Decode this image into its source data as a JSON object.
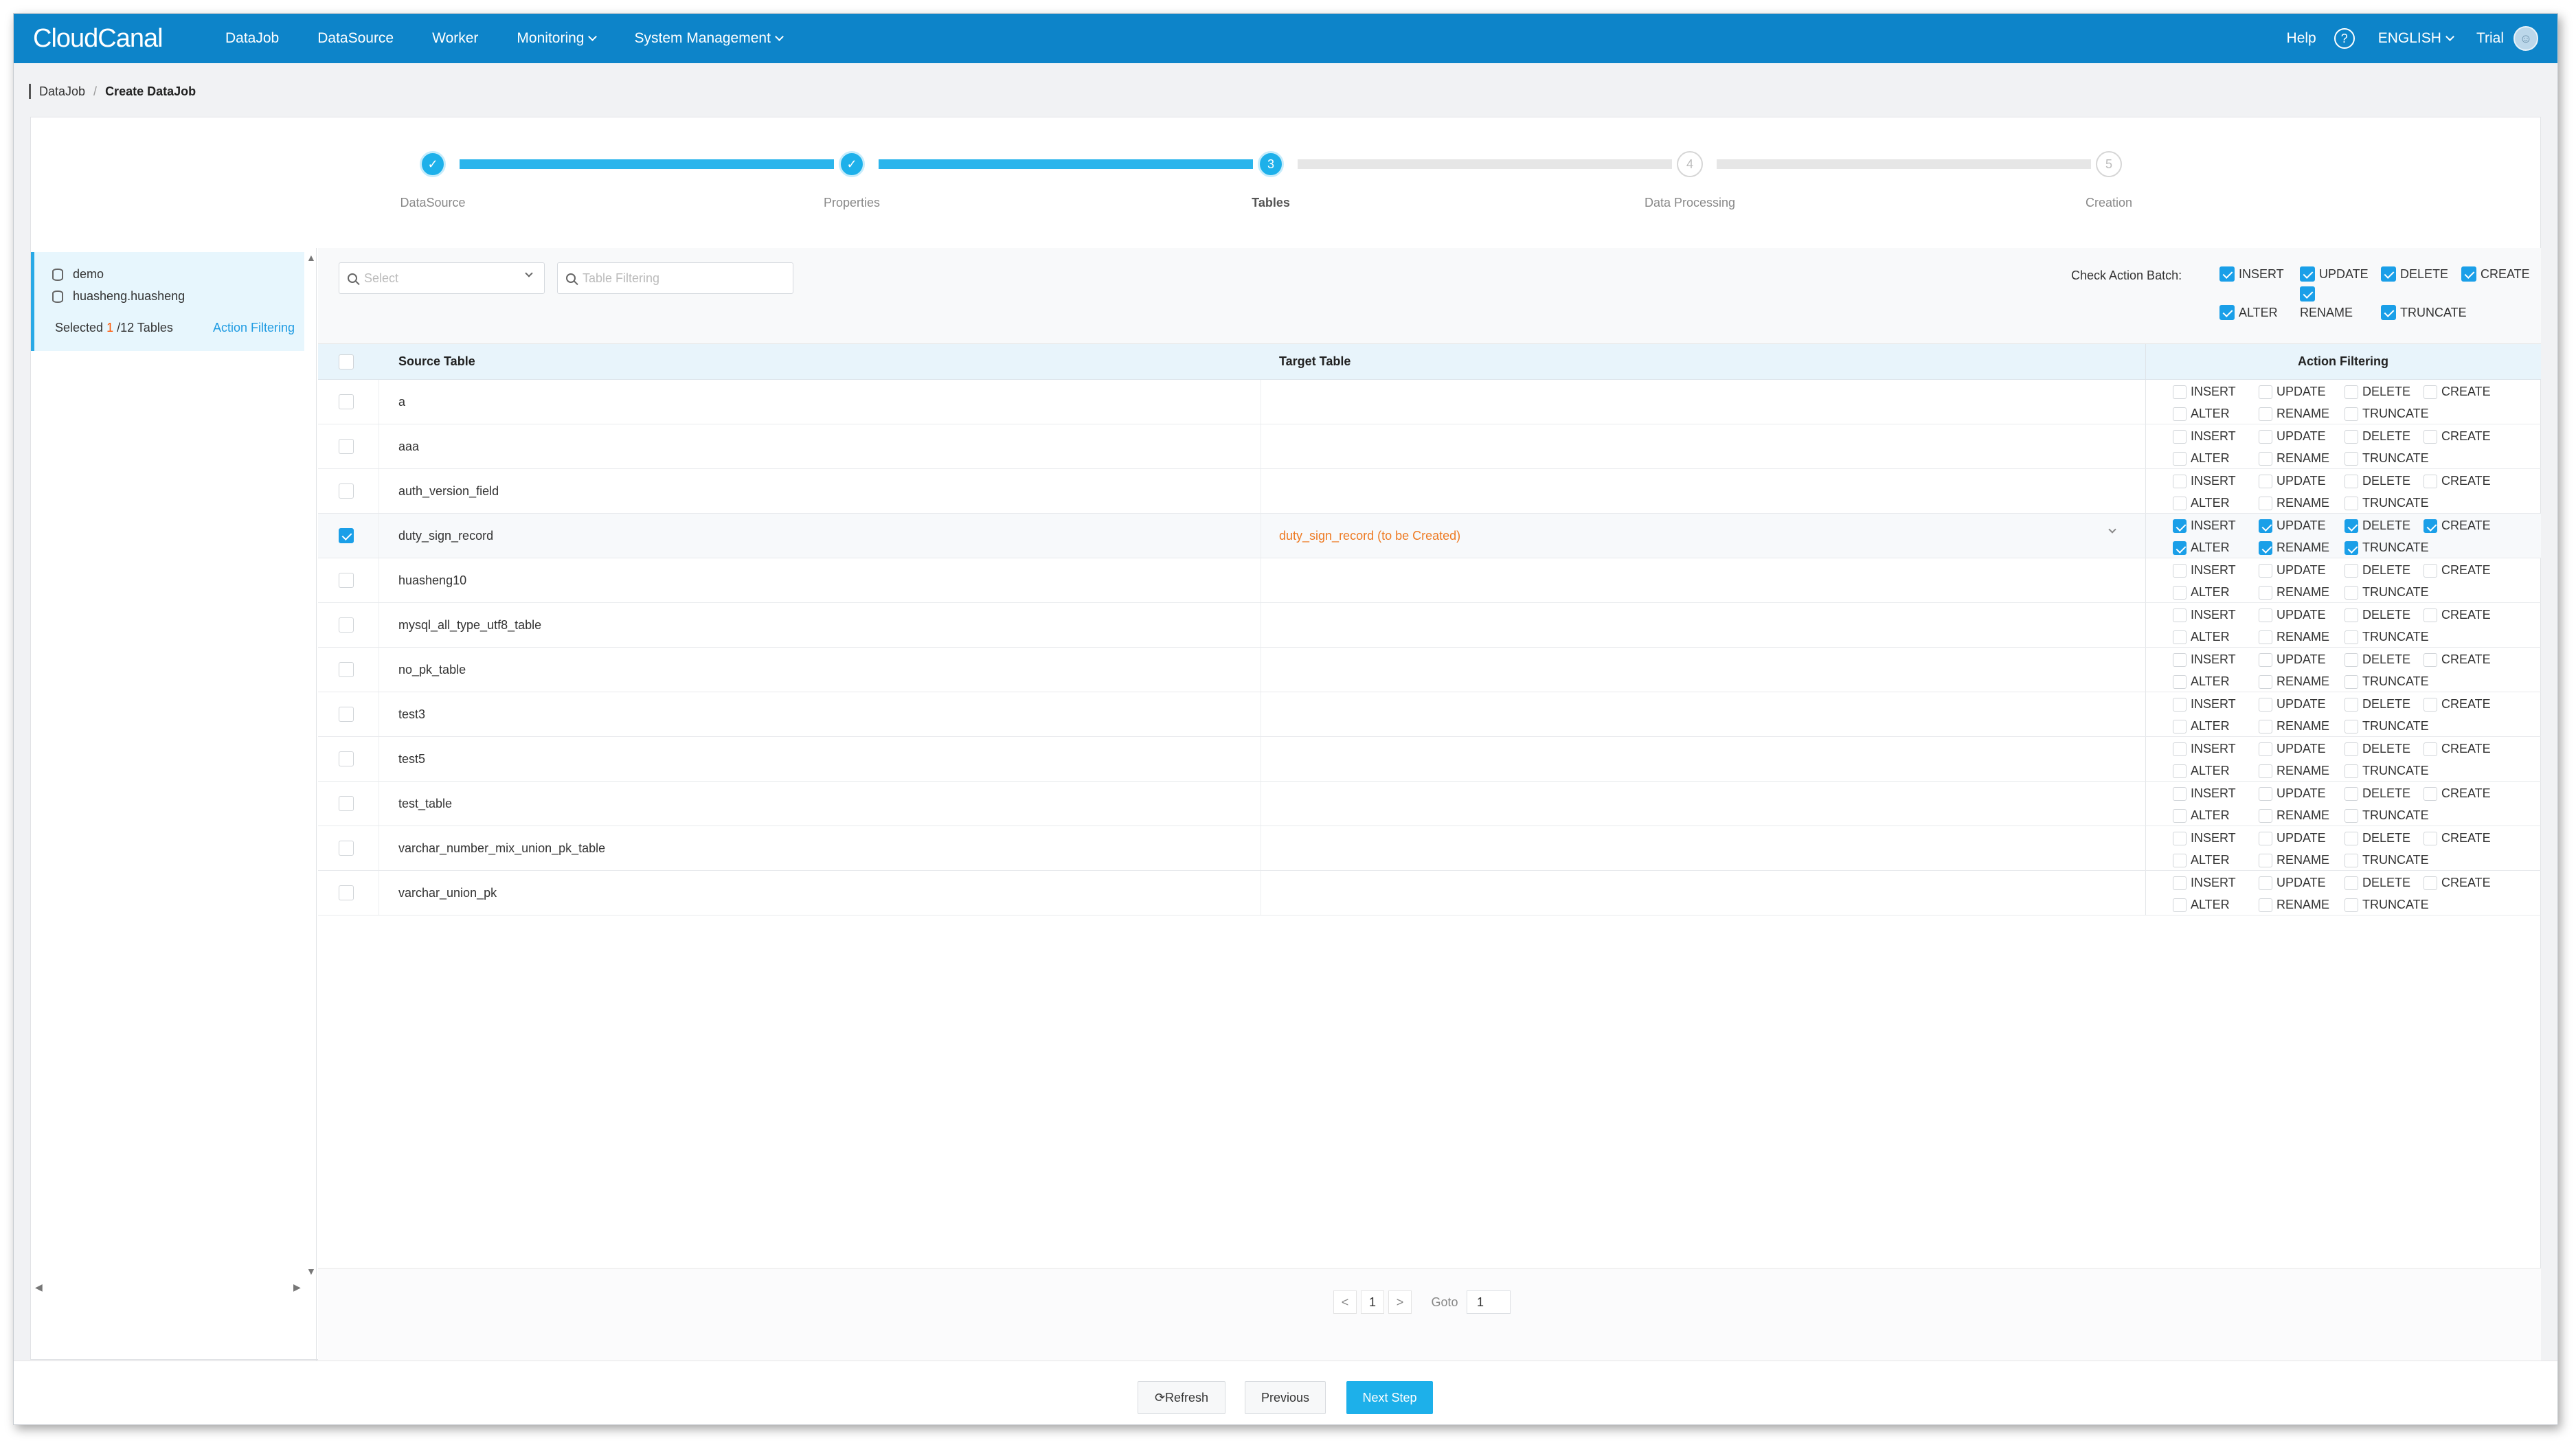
{
  "app": {
    "logo": "CloudCanal"
  },
  "topnav": {
    "items": [
      "DataJob",
      "DataSource",
      "Worker",
      "Monitoring",
      "System Management"
    ],
    "help": "Help",
    "help_icon": "?",
    "language": "ENGLISH",
    "user": "Trial"
  },
  "breadcrumb": {
    "parent": "DataJob",
    "separator": "/",
    "current": "Create DataJob"
  },
  "steps": [
    {
      "label": "DataSource",
      "status": "done",
      "symbol": "✓"
    },
    {
      "label": "Properties",
      "status": "done",
      "symbol": "✓"
    },
    {
      "label": "Tables",
      "status": "active",
      "symbol": "3"
    },
    {
      "label": "Data Processing",
      "status": "todo",
      "symbol": "4"
    },
    {
      "label": "Creation",
      "status": "todo",
      "symbol": "5"
    }
  ],
  "sidebar": {
    "db_name": "demo",
    "schema_name": "huasheng.huasheng",
    "selected_prefix": "Selected",
    "selected_count": "1",
    "selected_suffix": "/12 Tables",
    "action_filtering_link": "Action Filtering"
  },
  "filters": {
    "select_placeholder": "Select",
    "table_filter_placeholder": "Table Filtering",
    "batch_label": "Check Action Batch:",
    "batch_actions": [
      {
        "label": "INSERT",
        "checked": true
      },
      {
        "label": "UPDATE",
        "checked": true
      },
      {
        "label": "DELETE",
        "checked": true
      },
      {
        "label": "CREATE",
        "checked": true
      },
      {
        "label": "ALTER",
        "checked": true
      },
      {
        "label": "RENAME",
        "checked": true
      },
      {
        "label": "TRUNCATE",
        "checked": true
      }
    ]
  },
  "table": {
    "headers": {
      "source": "Source Table",
      "target": "Target Table",
      "action": "Action Filtering"
    },
    "action_labels": [
      "INSERT",
      "UPDATE",
      "DELETE",
      "CREATE",
      "ALTER",
      "RENAME",
      "TRUNCATE"
    ],
    "rows": [
      {
        "source": "a",
        "target": "",
        "checked": false
      },
      {
        "source": "aaa",
        "target": "",
        "checked": false
      },
      {
        "source": "auth_version_field",
        "target": "",
        "checked": false
      },
      {
        "source": "duty_sign_record",
        "target": "duty_sign_record (to be Created)",
        "checked": true
      },
      {
        "source": "huasheng10",
        "target": "",
        "checked": false
      },
      {
        "source": "mysql_all_type_utf8_table",
        "target": "",
        "checked": false
      },
      {
        "source": "no_pk_table",
        "target": "",
        "checked": false
      },
      {
        "source": "test3",
        "target": "",
        "checked": false
      },
      {
        "source": "test5",
        "target": "",
        "checked": false
      },
      {
        "source": "test_table",
        "target": "",
        "checked": false
      },
      {
        "source": "varchar_number_mix_union_pk_table",
        "target": "",
        "checked": false
      },
      {
        "source": "varchar_union_pk",
        "target": "",
        "checked": false
      }
    ]
  },
  "pagination": {
    "prev": "<",
    "page": "1",
    "next": ">",
    "goto_label": "Goto",
    "goto_value": "1"
  },
  "buttons": {
    "refresh": "⟳Refresh",
    "previous": "Previous",
    "next": "Next Step"
  },
  "colors": {
    "topbar": "#0d84c9",
    "accent": "#1db0ea",
    "target_new": "#ee7a22"
  }
}
